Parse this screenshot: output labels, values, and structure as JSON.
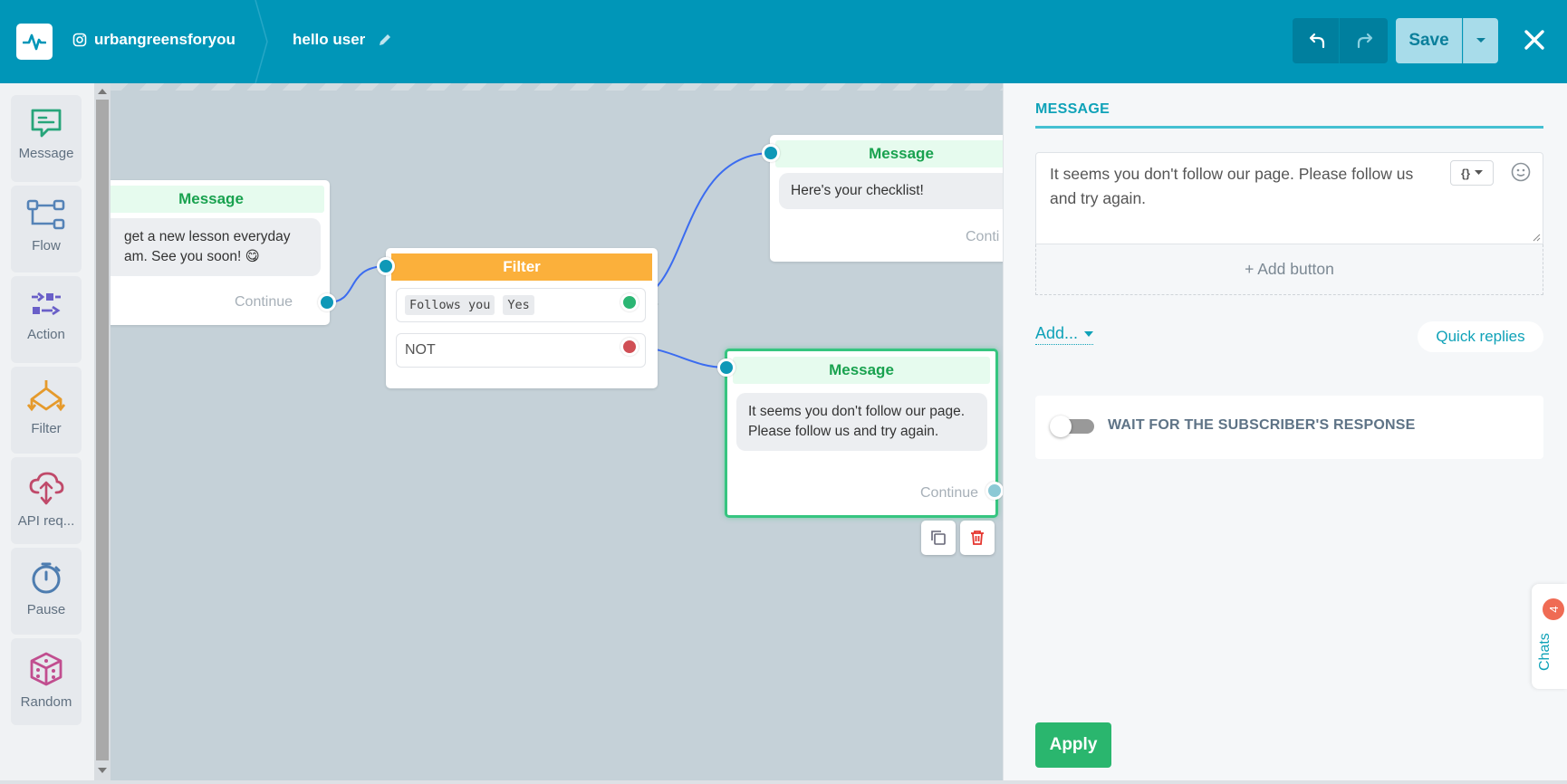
{
  "header": {
    "account_name": "urbangreensforyou",
    "flow_name": "hello user",
    "save_label": "Save",
    "brand_color": "#0096b8"
  },
  "palette": {
    "items": [
      {
        "label": "Message",
        "icon": "message-icon"
      },
      {
        "label": "Flow",
        "icon": "flow-icon"
      },
      {
        "label": "Action",
        "icon": "action-icon"
      },
      {
        "label": "Filter",
        "icon": "filter-icon"
      },
      {
        "label": "API req...",
        "icon": "cloud-icon"
      },
      {
        "label": "Pause",
        "icon": "stopwatch-icon"
      },
      {
        "label": "Random",
        "icon": "dice-icon"
      }
    ]
  },
  "canvas": {
    "node_left": {
      "title": "Message",
      "text_line1": "get a new lesson everyday",
      "text_line2": "am. See you soon! 😋",
      "continue": "Continue"
    },
    "node_filter": {
      "title": "Filter",
      "cond1_field": "Follows you",
      "cond1_value": "Yes",
      "cond2_label": "NOT"
    },
    "node_top": {
      "title": "Message",
      "text": "Here's your checklist!",
      "continue": "Conti"
    },
    "node_selected": {
      "title": "Message",
      "text": "It seems you don't follow our page. Please follow us and try again.",
      "continue": "Continue"
    }
  },
  "panel": {
    "title": "MESSAGE",
    "message_text": "It seems you don't follow our page. Please follow us and try again.",
    "var_button": "{}",
    "add_button": "+ Add button",
    "add_menu": "Add...",
    "quick_replies": "Quick replies",
    "wait_label": "WAIT FOR THE SUBSCRIBER'S RESPONSE",
    "wait_enabled": false,
    "apply": "Apply",
    "chats_label": "Chats",
    "chats_count": "4"
  }
}
